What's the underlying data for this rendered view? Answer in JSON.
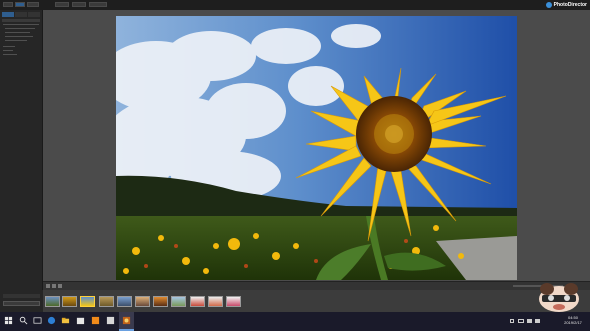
{
  "app": {
    "brand_name": "PhotoDirector",
    "accent": "#3a8fd9"
  },
  "left_panel": {
    "tabs": [
      "",
      "",
      ""
    ],
    "rows": [
      "",
      "",
      "",
      "",
      "",
      "",
      "",
      "",
      ""
    ]
  },
  "filmstrip": {
    "thumb_count": 12,
    "selected_index": 2
  },
  "taskbar": {
    "time": "04:50",
    "date": "2019/2/17",
    "icons": [
      "windows-start-icon",
      "search-icon",
      "task-view-icon",
      "edge-browser-icon",
      "file-explorer-icon",
      "store-icon",
      "mail-icon",
      "app-icon",
      "photodirector-icon"
    ]
  },
  "mascot": {
    "label": ""
  }
}
